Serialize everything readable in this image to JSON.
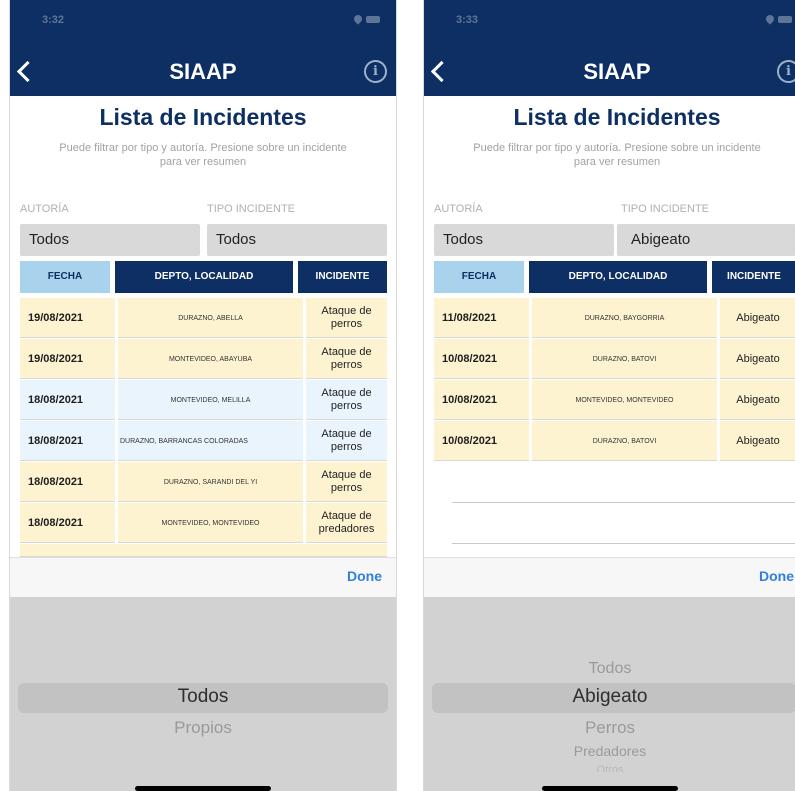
{
  "left": {
    "status": {
      "time": "3:32"
    },
    "nav": {
      "title": "SIAAP"
    },
    "header": {
      "title": "Lista de Incidentes",
      "subtitle": "Puede filtrar por tipo y autoría. Presione sobre un incidente para ver resumen"
    },
    "filters": {
      "autoria_label": "AUTORÍA",
      "autoria_value": "Todos",
      "tipo_label": "TIPO INCIDENTE",
      "tipo_value": "Todos"
    },
    "columns": {
      "fecha": "FECHA",
      "depto": "DEPTO, LOCALIDAD",
      "incidente": "INCIDENTE"
    },
    "rows": [
      {
        "fecha": "19/08/2021",
        "loc": "DURAZNO, ABELLA",
        "inc": "Ataque de perros"
      },
      {
        "fecha": "19/08/2021",
        "loc": "MONTEVIDEO, ABAYUBA",
        "inc": "Ataque de perros"
      },
      {
        "fecha": "18/08/2021",
        "loc": "MONTEVIDEO, MELILLA",
        "inc": "Ataque de perros"
      },
      {
        "fecha": "18/08/2021",
        "loc": "DURAZNO, BARRANCAS COLORADAS",
        "inc": "Ataque de perros"
      },
      {
        "fecha": "18/08/2021",
        "loc": "DURAZNO, SARANDI DEL YI",
        "inc": "Ataque de perros"
      },
      {
        "fecha": "18/08/2021",
        "loc": "MONTEVIDEO, MONTEVIDEO",
        "inc": "Ataque de predadores"
      }
    ],
    "toolbar": {
      "done": "Done"
    },
    "picker": {
      "options": [
        "Todos",
        "Propios"
      ],
      "selected": "Todos"
    }
  },
  "right": {
    "status": {
      "time": "3:33"
    },
    "nav": {
      "title": "SIAAP"
    },
    "header": {
      "title": "Lista de Incidentes",
      "subtitle": "Puede filtrar por tipo y autoría. Presione sobre un incidente para ver resumen"
    },
    "filters": {
      "autoria_label": "AUTORÍA",
      "autoria_value": "Todos",
      "tipo_label": "TIPO INCIDENTE",
      "tipo_value": "Abigeato"
    },
    "columns": {
      "fecha": "FECHA",
      "depto": "DEPTO, LOCALIDAD",
      "incidente": "INCIDENTE"
    },
    "rows": [
      {
        "fecha": "11/08/2021",
        "loc": "DURAZNO, BAYGORRIA",
        "inc": "Abigeato"
      },
      {
        "fecha": "10/08/2021",
        "loc": "DURAZNO, BATOVI",
        "inc": "Abigeato"
      },
      {
        "fecha": "10/08/2021",
        "loc": "MONTEVIDEO, MONTEVIDEO",
        "inc": "Abigeato"
      },
      {
        "fecha": "10/08/2021",
        "loc": "DURAZNO, BATOVI",
        "inc": "Abigeato"
      }
    ],
    "toolbar": {
      "done": "Done"
    },
    "picker": {
      "options": [
        "Todos",
        "Abigeato",
        "Perros",
        "Predadores",
        "Otros"
      ],
      "selected": "Abigeato"
    }
  },
  "colors": {
    "navy": "#0d2f63",
    "header_light_blue": "#a9d3ec",
    "row_yellow": "#fdf3d1",
    "row_blue": "#eaf4fd",
    "done_blue": "#2f7fe0"
  }
}
